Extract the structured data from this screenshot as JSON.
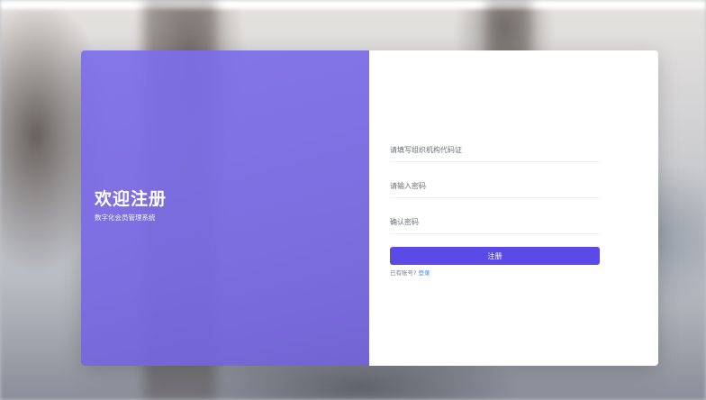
{
  "welcome": {
    "title": "欢迎注册",
    "subtitle": "数字化会员管理系统"
  },
  "form": {
    "org_code_placeholder": "请填写组织机构代码证",
    "password_placeholder": "请输入密码",
    "confirm_password_placeholder": "确认密码",
    "register_label": "注册",
    "login_hint": "已有账号?",
    "login_link": "登录"
  },
  "colors": {
    "accent": "#5b49e8",
    "panel": "#7c6eeb",
    "link": "#4a8bf0"
  }
}
